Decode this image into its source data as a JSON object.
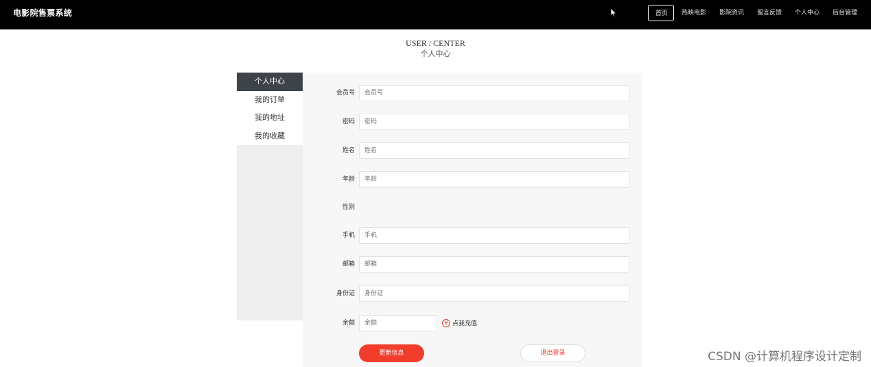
{
  "app": {
    "title": "电影院售票系统"
  },
  "nav": {
    "items": [
      {
        "label": "首页",
        "active": true
      },
      {
        "label": "热映电影"
      },
      {
        "label": "影院资讯"
      },
      {
        "label": "留言反馈"
      },
      {
        "label": "个人中心"
      },
      {
        "label": "后台管理"
      }
    ]
  },
  "heading": {
    "en": "USER / CENTER",
    "cn": "个人中心"
  },
  "side_menu": {
    "items": [
      {
        "label": "个人中心",
        "active": true
      },
      {
        "label": "我的订单"
      },
      {
        "label": "我的地址"
      },
      {
        "label": "我的收藏"
      }
    ]
  },
  "form": {
    "member_no": {
      "label": "会员号",
      "placeholder": "会员号"
    },
    "password": {
      "label": "密码",
      "placeholder": "密码"
    },
    "name": {
      "label": "姓名",
      "placeholder": "姓名"
    },
    "age": {
      "label": "年龄",
      "placeholder": "年龄"
    },
    "gender": {
      "label": "性别"
    },
    "phone": {
      "label": "手机",
      "placeholder": "手机"
    },
    "email": {
      "label": "邮箱",
      "placeholder": "邮箱"
    },
    "id_card": {
      "label": "身份证",
      "placeholder": "身份证"
    },
    "balance": {
      "label": "余额",
      "placeholder": "余额",
      "recharge_label": "点我充值",
      "recharge_icon": "¥"
    }
  },
  "buttons": {
    "update": "更新信息",
    "logout": "退出登录"
  },
  "watermark": "CSDN @计算机程序设计定制",
  "colors": {
    "nav_bg": "#000000",
    "accent": "#f23c2c",
    "side_active": "#3d4349"
  }
}
